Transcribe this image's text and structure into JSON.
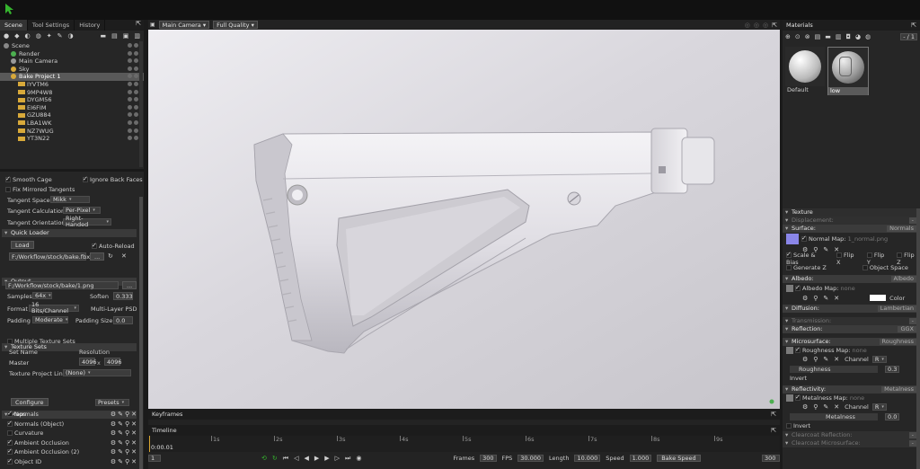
{
  "scene_panel": {
    "tabs": [
      "Scene",
      "Tool Settings",
      "History"
    ],
    "tree": [
      {
        "label": "Scene",
        "indent": 0,
        "icon": "scene"
      },
      {
        "label": "Render",
        "indent": 1,
        "icon": "render"
      },
      {
        "label": "Main Camera",
        "indent": 1,
        "icon": "camera"
      },
      {
        "label": "Sky",
        "indent": 1,
        "icon": "sky"
      },
      {
        "label": "Bake Project 1",
        "indent": 1,
        "icon": "bake",
        "selected": true
      },
      {
        "label": "IYVTM6",
        "indent": 2,
        "icon": "folder"
      },
      {
        "label": "9MP4W8",
        "indent": 2,
        "icon": "folder"
      },
      {
        "label": "DYGM56",
        "indent": 2,
        "icon": "folder"
      },
      {
        "label": "EI6FIM",
        "indent": 2,
        "icon": "folder"
      },
      {
        "label": "GZU884",
        "indent": 2,
        "icon": "folder"
      },
      {
        "label": "LBA1WK",
        "indent": 2,
        "icon": "folder"
      },
      {
        "label": "NZ7WUG",
        "indent": 2,
        "icon": "folder"
      },
      {
        "label": "YT3N22",
        "indent": 2,
        "icon": "folder"
      }
    ]
  },
  "settings": {
    "smooth_cage": "Smooth Cage",
    "ignore_back_faces": "Ignore Back Faces",
    "fix_mirrored": "Fix Mirrored Tangents",
    "tangent_space_label": "Tangent Space",
    "tangent_space": "Mikk",
    "tangent_calc_label": "Tangent Calculation",
    "tangent_calc": "Per-Pixel",
    "tangent_orient_label": "Tangent Orientation",
    "tangent_orient": "Right-Handed",
    "quick_loader": "Quick Loader",
    "load": "Load",
    "auto_reload": "Auto-Reload",
    "loader_path": "F:/Workflow/stock/bake.fbx",
    "browse": "...",
    "output": "Output",
    "output_path": "F:/Workflow/stock/bake/1.png",
    "samples_label": "Samples",
    "samples": "64x",
    "soften_label": "Soften",
    "soften": "0.333",
    "format_label": "Format",
    "format": "16 Bits/Channel",
    "multilayer": "Multi-Layer PSD",
    "padding_label": "Padding",
    "padding": "Moderate",
    "padding_size_label": "Padding Size:",
    "padding_size": "0.0",
    "texture_sets": "Texture Sets",
    "multiple_texture_sets": "Multiple Texture Sets",
    "set_name": "Set Name",
    "resolution": "Resolution",
    "master": "Master",
    "res_w": "4096",
    "res_x": "x",
    "res_h": "4096",
    "texture_project_link": "Texture Project Link",
    "none_opt": "(None)",
    "maps": "Maps",
    "configure": "Configure",
    "presets": "Presets",
    "map_items": [
      {
        "label": "Normals",
        "on": true
      },
      {
        "label": "Normals (Object)",
        "on": true
      },
      {
        "label": "Curvature",
        "on": false
      },
      {
        "label": "Ambient Occlusion",
        "on": true
      },
      {
        "label": "Ambient Occlusion (2)",
        "on": true
      },
      {
        "label": "Object ID",
        "on": true
      }
    ]
  },
  "viewport": {
    "camera": "Main Camera",
    "quality": "Full Quality"
  },
  "timeline": {
    "keyframes": "Keyframes",
    "timeline": "Timeline",
    "current_time": "0:00.01",
    "ticks": [
      "1s",
      "2s",
      "3s",
      "4s",
      "5s",
      "6s",
      "7s",
      "8s",
      "9s"
    ],
    "left_field": "1",
    "right_field": "300",
    "frames_label": "Frames",
    "frames": "300",
    "fps_label": "FPS",
    "fps": "30.000",
    "length_label": "Length",
    "length": "10.000",
    "speed_label": "Speed",
    "speed": "1.000",
    "bake_speed": "Bake Speed"
  },
  "materials": {
    "title": "Materials",
    "page": "- / 1",
    "thumbs": [
      "Default",
      "low"
    ],
    "texture": "Texture",
    "displacement": "Displacement:",
    "surface": "Surface:",
    "surface_v": "Normals",
    "normal_map": "Normal Map:",
    "normal_map_file": "1_normal.png",
    "scale_bias": "Scale & Bias",
    "flip_x": "Flip X",
    "flip_y": "Flip Y",
    "flip_z": "Flip Z",
    "generate_z": "Generate Z",
    "object_space": "Object Space",
    "albedo": "Albedo:",
    "albedo_v": "Albedo",
    "albedo_map": "Albedo Map:",
    "none": "none",
    "color": "Color",
    "diffusion": "Diffusion:",
    "diffusion_v": "Lambertian",
    "transmission": "Transmission:",
    "reflection": "Reflection:",
    "reflection_v": "GGX",
    "microsurface": "Microsurface:",
    "microsurface_v": "Roughness",
    "roughness_map": "Roughness Map:",
    "channel": "Channel",
    "channel_v": "R",
    "roughness": "Roughness",
    "roughness_val": "0.3",
    "invert": "Invert",
    "reflectivity": "Reflectivity:",
    "reflectivity_v": "Metalness",
    "metalness_map": "Metalness Map:",
    "metalness": "Metalness",
    "metalness_val": "0.0",
    "clearcoat_refl": "Clearcoat Reflection:",
    "clearcoat_micro": "Clearcoat Microsurface:"
  },
  "colors": {
    "accent_green": "#35b52e",
    "folder": "#d8a93a",
    "selection": "#595959"
  }
}
